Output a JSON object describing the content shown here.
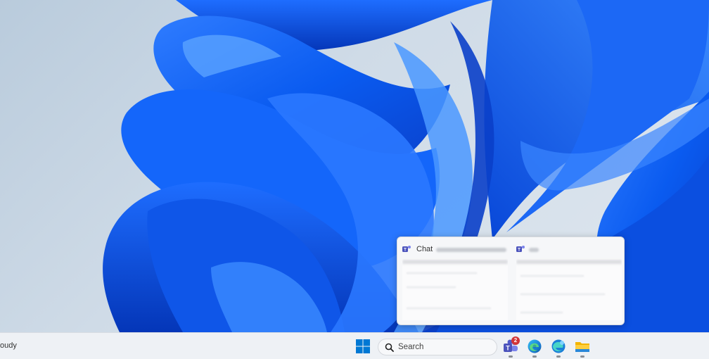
{
  "taskbar": {
    "weather_text": "oudy",
    "search": {
      "label": "Search",
      "icon": "search-icon"
    },
    "apps": [
      {
        "name": "teams",
        "icon": "teams-icon",
        "badge": "2"
      },
      {
        "name": "edge",
        "icon": "edge-icon"
      },
      {
        "name": "edge-beta",
        "icon": "edge-beta-icon"
      },
      {
        "name": "file-explorer",
        "icon": "folder-icon"
      }
    ]
  },
  "preview": {
    "windows": [
      {
        "title": "Chat",
        "app_icon": "teams-icon"
      },
      {
        "title": "",
        "app_icon": "teams-icon"
      }
    ]
  },
  "colors": {
    "wallpaper_blue": "#0a5bf0",
    "taskbar_bg": "#eef1f5",
    "start_blue": "#0078d4",
    "badge_red": "#d13438"
  }
}
